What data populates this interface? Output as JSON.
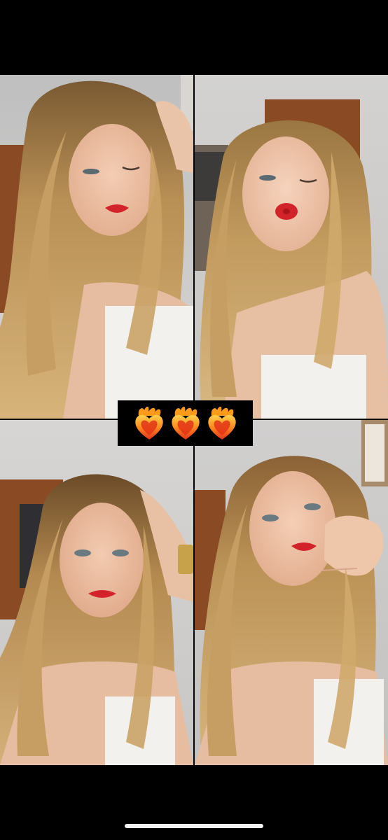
{
  "screen": {
    "background": "#000000",
    "accent_colors": {
      "lip_red": "#d2232a",
      "hair_blonde": "#c9a468",
      "top_white": "#f3f1ee",
      "wall_grey": "#cfcdcc",
      "door_wood": "#8a4a24"
    }
  },
  "collage": {
    "layout": "2x2 grid",
    "photos": [
      {
        "name": "selfie-wink",
        "description_icon": "photo"
      },
      {
        "name": "selfie-kiss",
        "description_icon": "photo"
      },
      {
        "name": "selfie-hand-on-head",
        "description_icon": "photo"
      },
      {
        "name": "selfie-hand-on-cheek",
        "description_icon": "photo"
      }
    ]
  },
  "sticker": {
    "icons": [
      "heart-on-fire-icon",
      "heart-on-fire-icon",
      "heart-on-fire-icon"
    ],
    "count": 3
  },
  "system": {
    "home_indicator": "home-indicator"
  }
}
